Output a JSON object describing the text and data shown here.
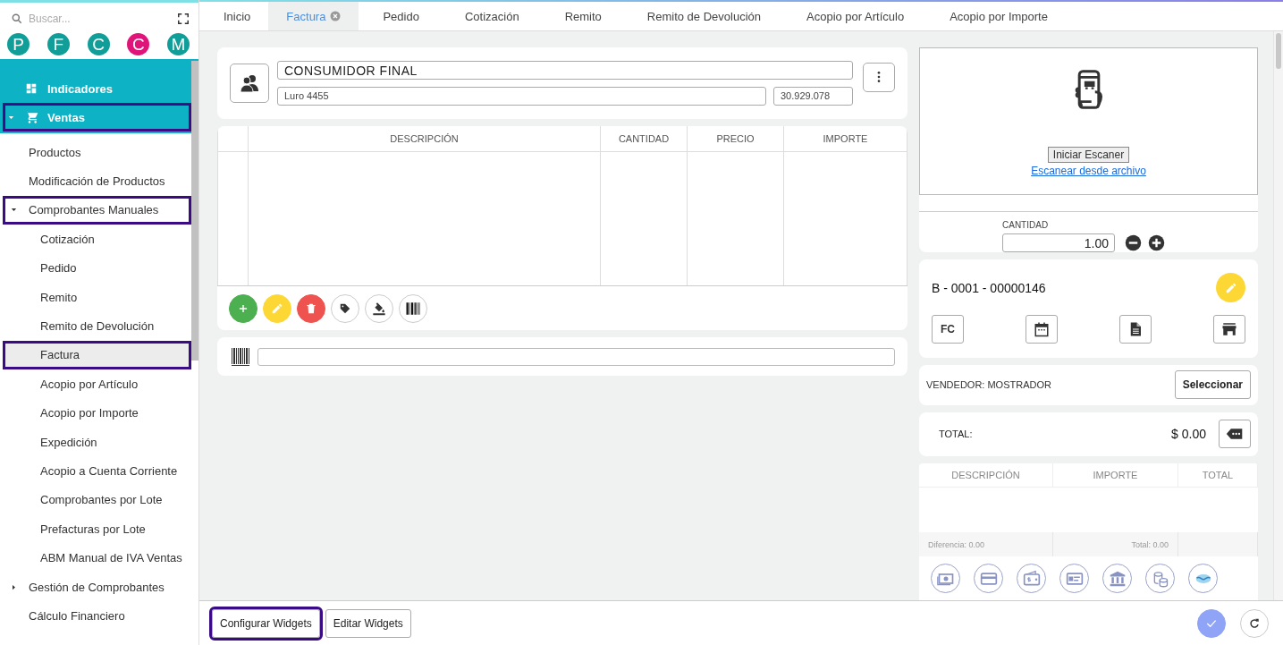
{
  "sidebar": {
    "search": {
      "placeholder": "Buscar..."
    },
    "avatars": [
      {
        "letter": "P",
        "color": "#119e98"
      },
      {
        "letter": "F",
        "color": "#119e98"
      },
      {
        "letter": "C",
        "color": "#119e98"
      },
      {
        "letter": "C",
        "color": "#e0157a"
      },
      {
        "letter": "M",
        "color": "#119e98"
      }
    ],
    "items": [
      {
        "label": "Indicadores",
        "selected": false,
        "highlighted": false
      },
      {
        "label": "Ventas",
        "selected": false,
        "highlighted": true,
        "expanded": true,
        "children": [
          {
            "label": "Productos",
            "selected": false,
            "highlighted": false
          },
          {
            "label": "Modificación de Productos",
            "selected": false,
            "highlighted": false
          },
          {
            "label": "Comprobantes Manuales",
            "selected": false,
            "highlighted": true,
            "expanded": true,
            "children": [
              {
                "label": "Cotización",
                "selected": false,
                "highlighted": false
              },
              {
                "label": "Pedido",
                "selected": false,
                "highlighted": false
              },
              {
                "label": "Remito",
                "selected": false,
                "highlighted": false
              },
              {
                "label": "Remito de Devolución",
                "selected": false,
                "highlighted": false
              },
              {
                "label": "Factura",
                "selected": true,
                "highlighted": true
              },
              {
                "label": "Acopio por Artículo",
                "selected": false,
                "highlighted": false
              },
              {
                "label": "Acopio por Importe",
                "selected": false,
                "highlighted": false
              },
              {
                "label": "Expedición",
                "selected": false,
                "highlighted": false
              },
              {
                "label": "Acopio a Cuenta Corriente",
                "selected": false,
                "highlighted": false
              },
              {
                "label": "Comprobantes por Lote",
                "selected": false,
                "highlighted": false
              },
              {
                "label": "Prefacturas por Lote",
                "selected": false,
                "highlighted": false
              },
              {
                "label": "ABM Manual de IVA Ventas",
                "selected": false,
                "highlighted": false
              }
            ]
          },
          {
            "label": "Gestión de Comprobantes",
            "selected": false,
            "highlighted": false,
            "expanded": false
          },
          {
            "label": "Cálculo Financiero",
            "selected": false,
            "highlighted": false
          }
        ]
      }
    ]
  },
  "tabs": [
    {
      "label": "Inicio",
      "selected": false,
      "closable": false
    },
    {
      "label": "Factura",
      "selected": true,
      "closable": true
    },
    {
      "label": "Pedido",
      "selected": false,
      "closable": false
    },
    {
      "label": "Cotización",
      "selected": false,
      "closable": false
    },
    {
      "label": "Remito",
      "selected": false,
      "closable": false
    },
    {
      "label": "Remito de Devolución",
      "selected": false,
      "closable": false
    },
    {
      "label": "Acopio por Artículo",
      "selected": false,
      "closable": false
    },
    {
      "label": "Acopio por Importe",
      "selected": false,
      "closable": false
    }
  ],
  "customer": {
    "name": "CONSUMIDOR FINAL",
    "address": "Luro 4455",
    "document": "30.929.078"
  },
  "items_table": {
    "columns": [
      "DESCRIPCIÓN",
      "CANTIDAD",
      "PRECIO",
      "IMPORTE"
    ]
  },
  "scanner": {
    "start_button": "Iniciar Escaner",
    "file_link": "Escanear desde archivo"
  },
  "quantity": {
    "label": "CANTIDAD",
    "value": "1.00"
  },
  "voucher": {
    "number": "B - 0001 - 00000146",
    "type": "FC"
  },
  "seller": {
    "label": "VENDEDOR: MOSTRADOR",
    "button": "Seleccionar"
  },
  "total": {
    "label": "TOTAL:",
    "amount": "$ 0.00"
  },
  "payments_table": {
    "columns": [
      "DESCRIPCIÓN",
      "IMPORTE",
      "TOTAL"
    ],
    "difference": "Diferencia: 0.00",
    "total": "Total: 0.00"
  },
  "footer": {
    "buttons": [
      {
        "label": "Configurar Widgets",
        "highlighted": true
      },
      {
        "label": "Editar Widgets",
        "highlighted": false
      }
    ]
  }
}
